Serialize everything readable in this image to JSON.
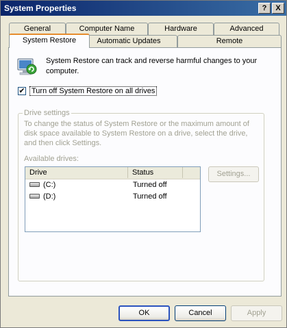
{
  "window": {
    "title": "System Properties"
  },
  "titlebar": {
    "help_label": "?",
    "close_label": "X"
  },
  "tabs_back": [
    {
      "label": "General"
    },
    {
      "label": "Computer Name"
    },
    {
      "label": "Hardware"
    },
    {
      "label": "Advanced"
    }
  ],
  "tabs_front": [
    {
      "label": "System Restore",
      "active": true
    },
    {
      "label": "Automatic Updates"
    },
    {
      "label": "Remote"
    }
  ],
  "system_restore": {
    "intro": "System Restore can track and reverse harmful changes to your computer.",
    "turn_off_checkbox": {
      "label": "Turn off System Restore on all drives",
      "checked": true
    },
    "drive_settings": {
      "legend": "Drive settings",
      "description": "To change the status of System Restore or the maximum amount of disk space available to System Restore on a drive, select the drive, and then click Settings.",
      "available_label": "Available drives:",
      "columns": [
        "Drive",
        "Status"
      ],
      "drives": [
        {
          "name": "(C:)",
          "status": "Turned off",
          "icon": "hard-drive-icon"
        },
        {
          "name": "(D:)",
          "status": "Turned off",
          "icon": "hard-drive-icon"
        }
      ],
      "settings_button": "Settings..."
    }
  },
  "footer": {
    "ok": "OK",
    "cancel": "Cancel",
    "apply": "Apply"
  },
  "colors": {
    "title_bar": "#0a246a",
    "active_tab_accent": "#e68b2c",
    "disabled_text": "#a1a192"
  }
}
